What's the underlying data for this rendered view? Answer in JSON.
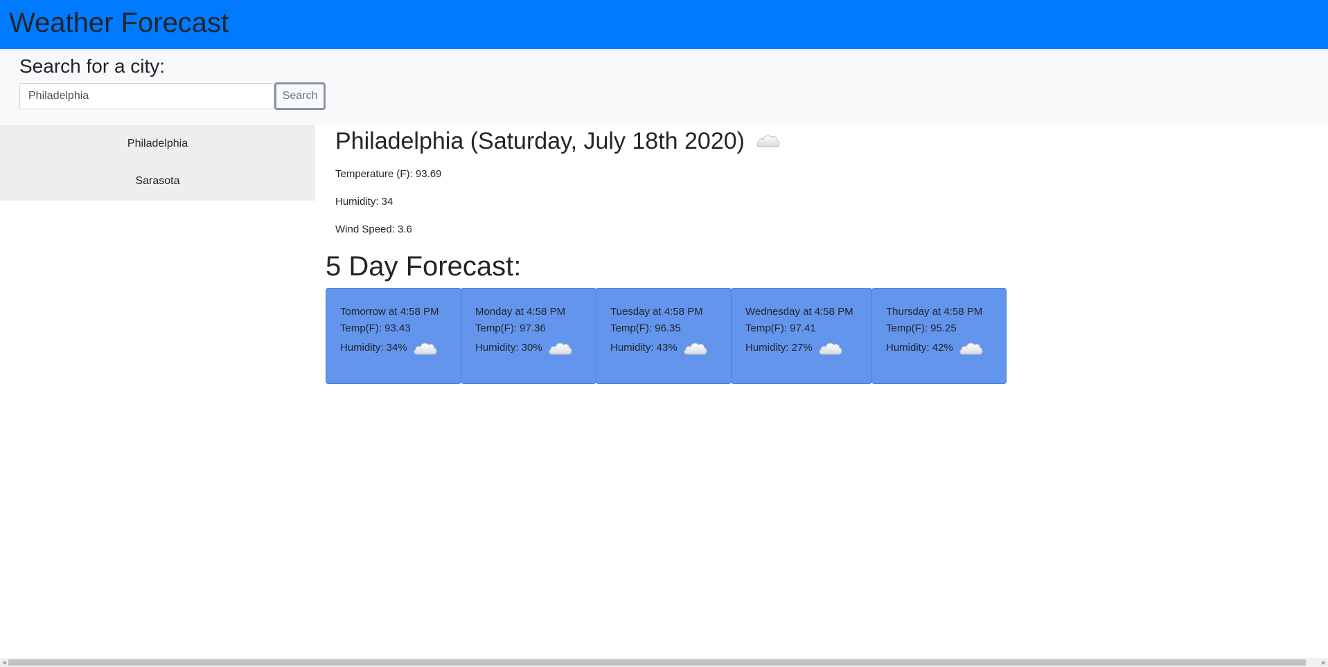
{
  "app": {
    "title": "Weather Forecast"
  },
  "search": {
    "heading": "Search for a city:",
    "input_value": "Philadelphia",
    "button_label": "Search"
  },
  "history": {
    "items": [
      {
        "label": "Philadelphia"
      },
      {
        "label": "Sarasota"
      }
    ]
  },
  "current": {
    "title": "Philadelphia (Saturday, July 18th 2020)",
    "icon": "cloud-icon",
    "temperature": "Temperature (F): 93.69",
    "humidity": "Humidity: 34",
    "wind": "Wind Speed: 3.6"
  },
  "forecast": {
    "heading": "5 Day Forecast:",
    "days": [
      {
        "when": "Tomorrow at 4:58 PM",
        "temp": "Temp(F): 93.43",
        "humidity": "Humidity: 34%",
        "icon": "cloud-icon"
      },
      {
        "when": "Monday at 4:58 PM",
        "temp": "Temp(F): 97.36",
        "humidity": "Humidity: 30%",
        "icon": "cloud-icon"
      },
      {
        "when": "Tuesday at 4:58 PM",
        "temp": "Temp(F): 96.35",
        "humidity": "Humidity: 43%",
        "icon": "cloud-icon"
      },
      {
        "when": "Wednesday at 4:58 PM",
        "temp": "Temp(F): 97.41",
        "humidity": "Humidity: 27%",
        "icon": "cloud-icon"
      },
      {
        "when": "Thursday at 4:58 PM",
        "temp": "Temp(F): 95.25",
        "humidity": "Humidity: 42%",
        "icon": "cloud-icon"
      }
    ]
  },
  "colors": {
    "navbar": "#007bff",
    "search_band": "#f8f9fa",
    "sidebar": "#eeeeee",
    "card": "#6495ed",
    "text": "#212529"
  }
}
